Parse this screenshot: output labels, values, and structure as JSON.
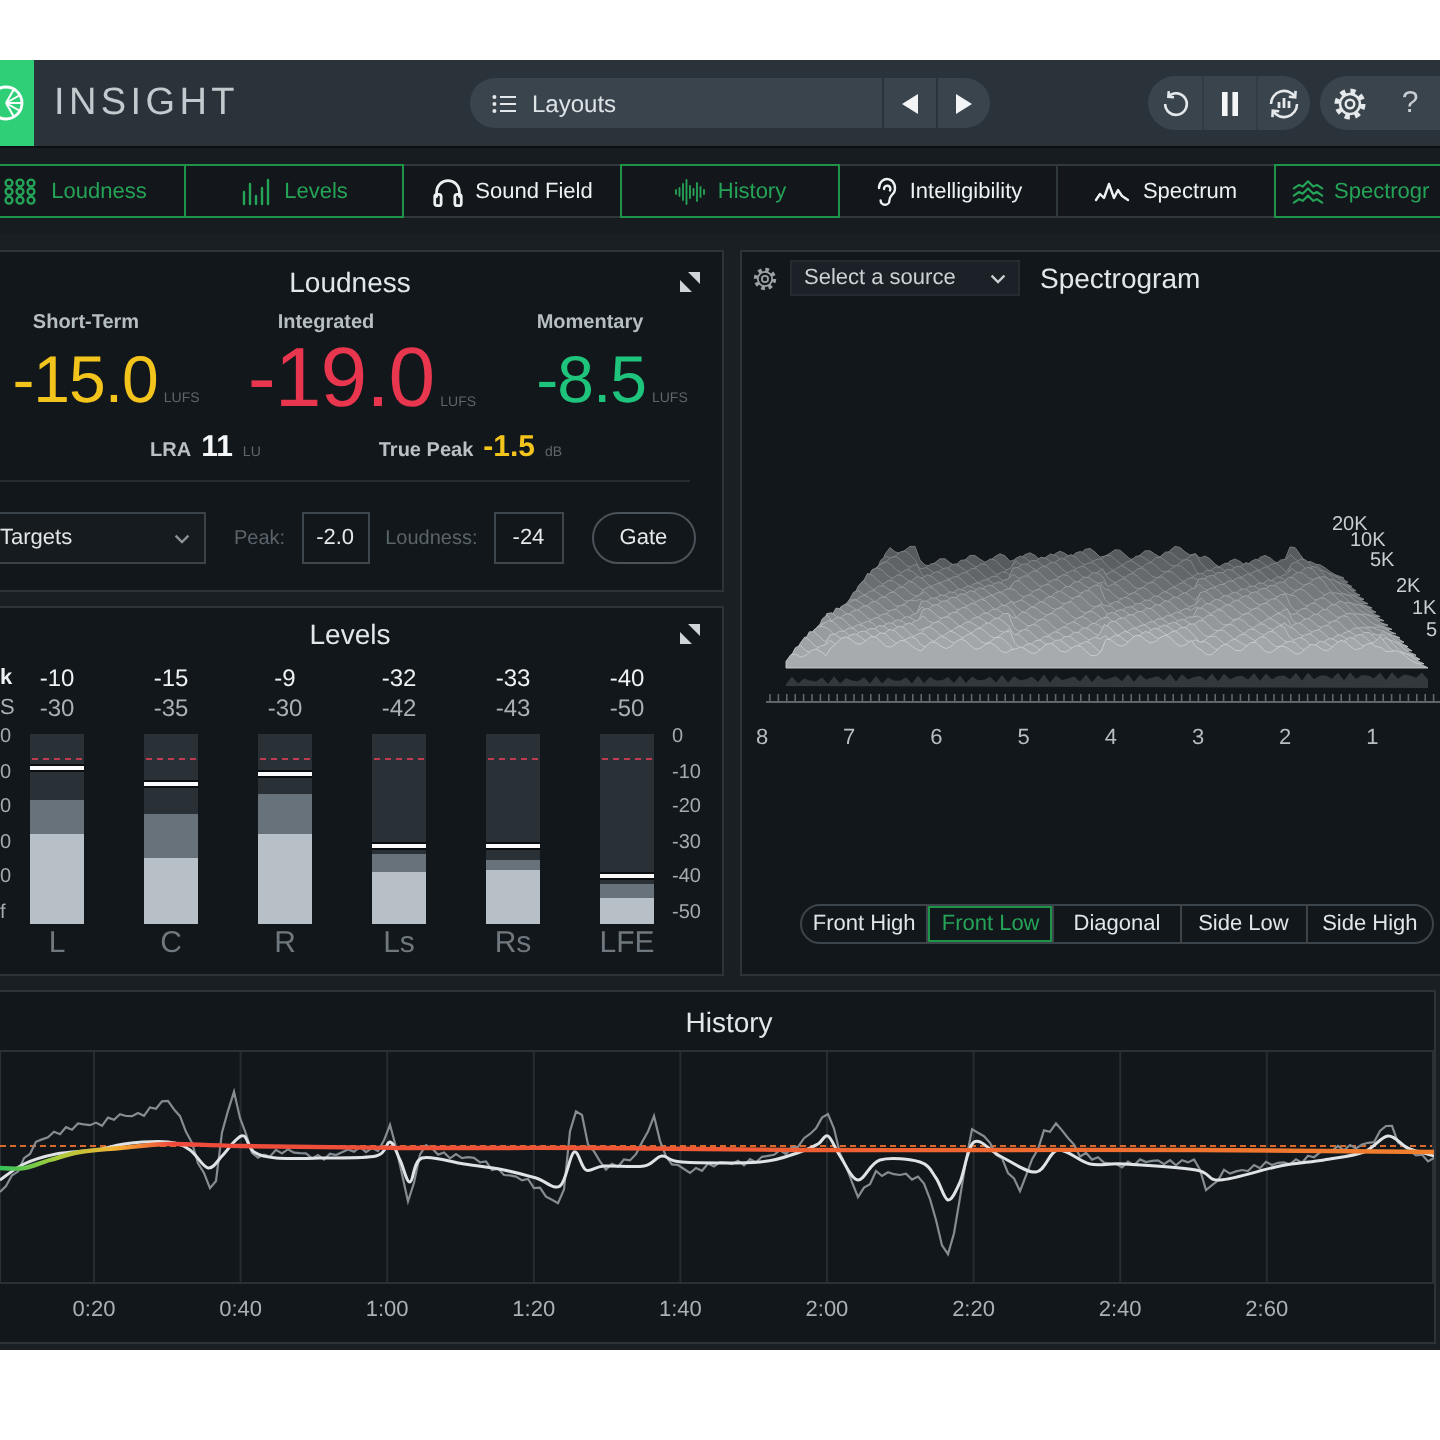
{
  "header": {
    "title": "INSIGHT",
    "layouts_label": "Layouts",
    "help_label": "?"
  },
  "tabs": [
    {
      "kind": "loudness",
      "label": "Loudness",
      "selected": true
    },
    {
      "kind": "levels",
      "label": "Levels",
      "selected": true
    },
    {
      "kind": "sound_field",
      "label": "Sound Field",
      "selected": false
    },
    {
      "kind": "history",
      "label": "History",
      "selected": true
    },
    {
      "kind": "intelligibility",
      "label": "Intelligibility",
      "selected": false
    },
    {
      "kind": "spectrum",
      "label": "Spectrum",
      "selected": false
    },
    {
      "kind": "spectrogram",
      "label": "Spectrogr",
      "selected": true
    }
  ],
  "loudness": {
    "title": "Loudness",
    "columns": [
      {
        "kind": "secondary",
        "label": "Short-Term",
        "value": "-15.0",
        "unit": "LUFS",
        "color": "#f3c41c"
      },
      {
        "kind": "primary",
        "label": "Integrated",
        "value": "-19.0",
        "unit": "LUFS",
        "color": "#e8364f"
      },
      {
        "kind": "secondary",
        "label": "Momentary",
        "value": "-8.5",
        "unit": "LUFS",
        "color": "#1fc47c"
      }
    ],
    "stats": [
      {
        "label": "LRA",
        "value": "11",
        "unit": "LU",
        "color": "#f4f6f7"
      },
      {
        "label": "True Peak",
        "value": "-1.5",
        "unit": "dB",
        "color": "#f3c41c"
      }
    ],
    "targets_dropdown": {
      "value": "Targets"
    },
    "peak_field": {
      "label": "Peak:",
      "value": "-2.0"
    },
    "loudness_field": {
      "label": "Loudness:",
      "value": "-24"
    },
    "gate_button": "Gate"
  },
  "levels": {
    "title": "Levels",
    "row_labels": [
      "k",
      "S"
    ],
    "left_scale": [
      "0",
      "0",
      "0",
      "0",
      "0",
      "f"
    ],
    "right_scale": [
      "0",
      "-10",
      "-20",
      "-30",
      "-40",
      "-50"
    ],
    "target_line": {
      "level": 0.86
    },
    "channels": [
      {
        "name": "L",
        "top_reading": "-10",
        "bottom_reading": "-30",
        "fill": {
          "level": 0.47
        },
        "outer_fill": {
          "level": 0.65
        },
        "marker": {
          "level": 0.82
        }
      },
      {
        "name": "C",
        "top_reading": "-15",
        "bottom_reading": "-35",
        "fill": {
          "level": 0.35
        },
        "outer_fill": {
          "level": 0.58
        },
        "marker": {
          "level": 0.74
        }
      },
      {
        "name": "R",
        "top_reading": "-9",
        "bottom_reading": "-30",
        "fill": {
          "level": 0.47
        },
        "outer_fill": {
          "level": 0.68
        },
        "marker": {
          "level": 0.79
        }
      },
      {
        "name": "Ls",
        "top_reading": "-32",
        "bottom_reading": "-42",
        "fill": {
          "level": 0.27
        },
        "outer_fill": {
          "level": 0.37
        },
        "marker": {
          "level": 0.41
        }
      },
      {
        "name": "Rs",
        "top_reading": "-33",
        "bottom_reading": "-43",
        "fill": {
          "level": 0.28
        },
        "outer_fill": {
          "level": 0.34
        },
        "marker": {
          "level": 0.41
        }
      },
      {
        "name": "LFE",
        "top_reading": "-40",
        "bottom_reading": "-50",
        "fill": {
          "level": 0.14
        },
        "outer_fill": {
          "level": 0.21
        },
        "marker": {
          "level": 0.25
        }
      }
    ]
  },
  "spectrogram": {
    "source_dropdown": {
      "value": "Select a source"
    },
    "title": "Spectrogram",
    "frequency_labels": [
      "20K",
      "10K",
      "5K",
      "2K",
      "1K",
      "5"
    ],
    "time_labels": [
      "8",
      "7",
      "6",
      "5",
      "4",
      "3",
      "2",
      "1"
    ],
    "views": [
      {
        "label": "Front High",
        "selected": false
      },
      {
        "label": "Front Low",
        "selected": true
      },
      {
        "label": "Diagonal",
        "selected": false
      },
      {
        "label": "Side Low",
        "selected": false
      },
      {
        "label": "Side High",
        "selected": false
      }
    ]
  },
  "history": {
    "title": "History",
    "time_labels": [
      "0:20",
      "0:40",
      "1:00",
      "1:20",
      "1:40",
      "2:00",
      "2:20",
      "2:40",
      "2:60"
    ]
  }
}
